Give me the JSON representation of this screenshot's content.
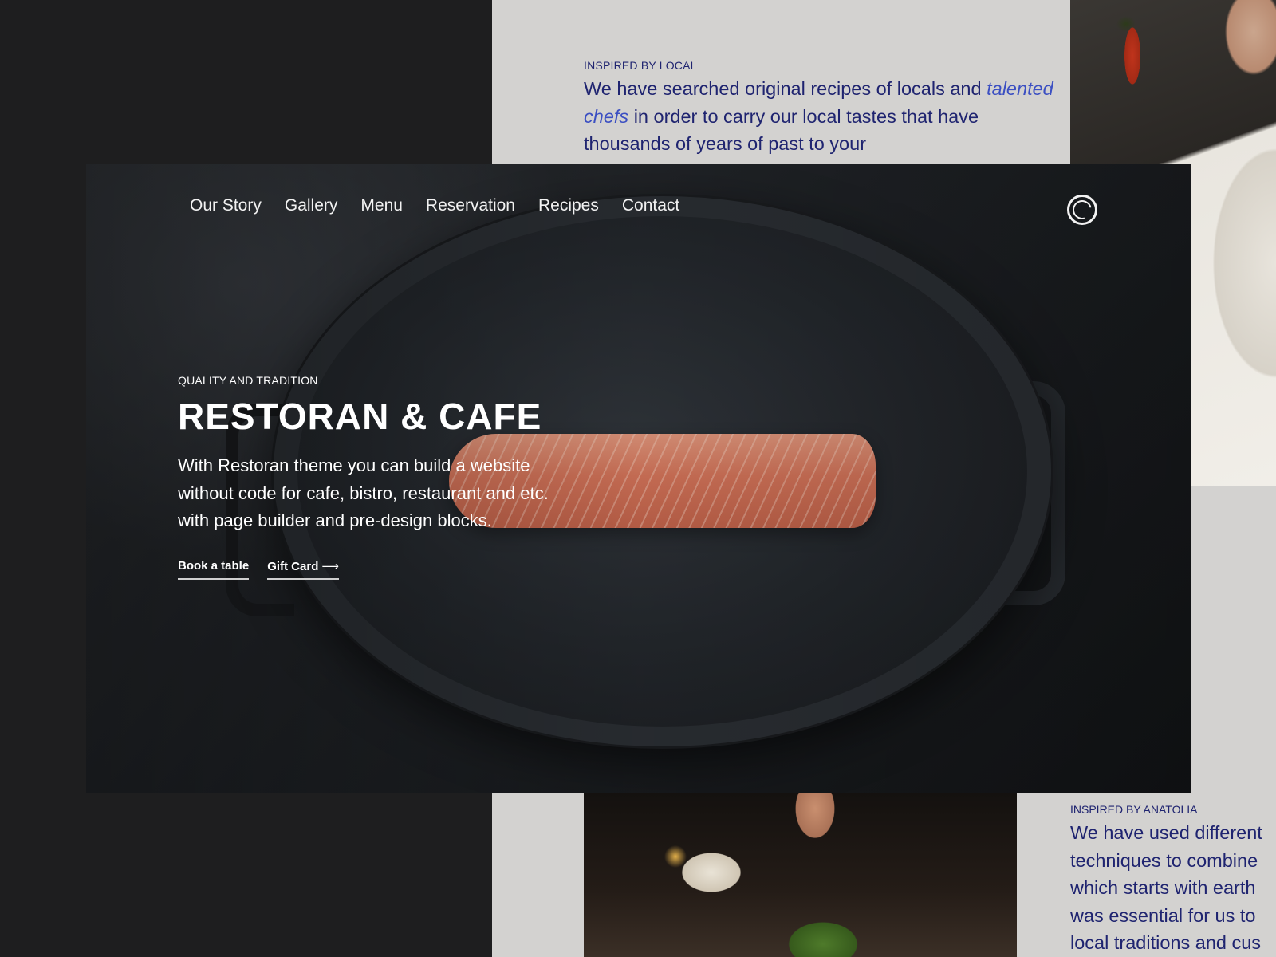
{
  "top_section": {
    "eyebrow": "INSPIRED BY LOCAL",
    "text_before": "We have searched original recipes of locals and ",
    "text_accent": "talented chefs",
    "text_after": " in order to carry our local tastes that have thousands of years of past to your"
  },
  "nav": {
    "items": [
      "Our Story",
      "Gallery",
      "Menu",
      "Reservation",
      "Recipes",
      "Contact"
    ]
  },
  "hero": {
    "eyebrow": "QUALITY AND TRADITION",
    "title": "RESTORAN & CAFE",
    "description": "With Restoran theme you can build a website\nwithout code for cafe, bistro, restaurant and etc.\nwith page builder and pre-design blocks.",
    "primary_action": "Book a table",
    "secondary_action": "Gift Card",
    "secondary_arrow": "⟶"
  },
  "bottom_section": {
    "eyebrow": "INSPIRED BY ANATOLIA",
    "lines": [
      "We have used different",
      "techniques to combine",
      "which starts with earth",
      "was essential for us to",
      "local traditions and cus"
    ]
  },
  "colors": {
    "accent_text": "#1f2470",
    "accent_italic": "#3b4fc2",
    "background_dark": "#1e1e1f",
    "background_light": "#d3d2d0"
  }
}
